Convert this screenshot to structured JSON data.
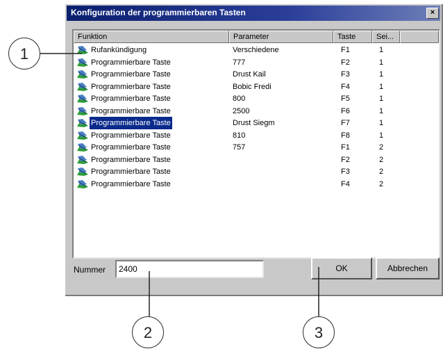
{
  "dialog": {
    "title": "Konfiguration der programmierbaren Tasten",
    "close_label": "×"
  },
  "list": {
    "columns": [
      "Funktion",
      "Parameter",
      "Taste",
      "Sei..."
    ],
    "rows": [
      {
        "funktion": "Rufankündigung",
        "parameter": "Verschiedene",
        "taste": "F1",
        "seite": "1",
        "icon": "announcement-icon"
      },
      {
        "funktion": "Programmierbare Taste",
        "parameter": "777",
        "taste": "F2",
        "seite": "1",
        "icon": "key-icon"
      },
      {
        "funktion": "Programmierbare Taste",
        "parameter": "Drust Kail",
        "taste": "F3",
        "seite": "1",
        "icon": "key-icon"
      },
      {
        "funktion": "Programmierbare Taste",
        "parameter": "Bobic Fredi",
        "taste": "F4",
        "seite": "1",
        "icon": "key-icon"
      },
      {
        "funktion": "Programmierbare Taste",
        "parameter": "800",
        "taste": "F5",
        "seite": "1",
        "icon": "key-icon"
      },
      {
        "funktion": "Programmierbare Taste",
        "parameter": "2500",
        "taste": "F6",
        "seite": "1",
        "icon": "key-icon"
      },
      {
        "funktion": "Programmierbare Taste",
        "parameter": "Drust Siegm",
        "taste": "F7",
        "seite": "1",
        "icon": "key-icon",
        "selected": true
      },
      {
        "funktion": "Programmierbare Taste",
        "parameter": "810",
        "taste": "F8",
        "seite": "1",
        "icon": "key-icon"
      },
      {
        "funktion": "Programmierbare Taste",
        "parameter": "757",
        "taste": "F1",
        "seite": "2",
        "icon": "key-icon"
      },
      {
        "funktion": "Programmierbare Taste",
        "parameter": "",
        "taste": "F2",
        "seite": "2",
        "icon": "key-icon"
      },
      {
        "funktion": "Programmierbare Taste",
        "parameter": "",
        "taste": "F3",
        "seite": "2",
        "icon": "key-icon"
      },
      {
        "funktion": "Programmierbare Taste",
        "parameter": "",
        "taste": "F4",
        "seite": "2",
        "icon": "key-icon"
      }
    ]
  },
  "footer": {
    "nummer_label": "Nummer",
    "nummer_value": "2400",
    "ok_label": "OK",
    "cancel_label": "Abbrechen"
  },
  "callouts": [
    "1",
    "2",
    "3"
  ],
  "colors": {
    "selection": "#0a2a8c",
    "title_bar": "#0a1f6e",
    "face": "#c8c8c8"
  }
}
